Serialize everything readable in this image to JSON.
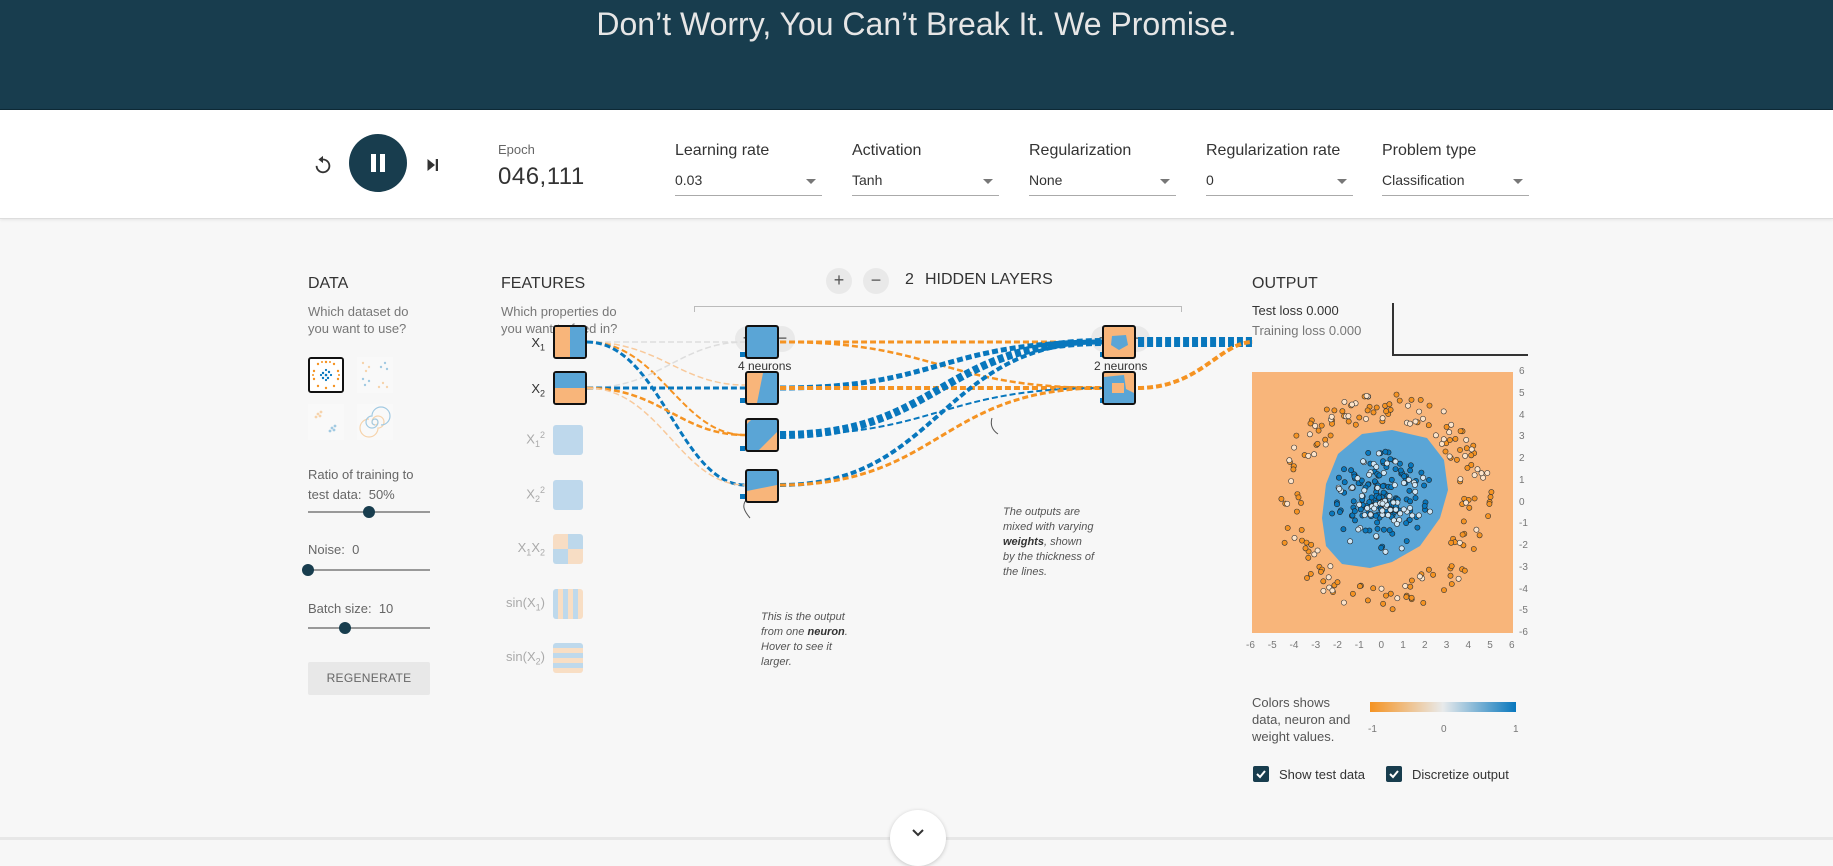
{
  "banner": {
    "title": "Don’t Worry, You Can’t Break It. We Promise."
  },
  "controls": {
    "epoch_label": "Epoch",
    "epoch_value": "046,111",
    "learning_rate": {
      "label": "Learning rate",
      "value": "0.03"
    },
    "activation": {
      "label": "Activation",
      "value": "Tanh"
    },
    "regularization": {
      "label": "Regularization",
      "value": "None"
    },
    "regularization_rate": {
      "label": "Regularization rate",
      "value": "0"
    },
    "problem_type": {
      "label": "Problem type",
      "value": "Classification"
    }
  },
  "data_panel": {
    "title": "DATA",
    "subtitle_1": "Which dataset do",
    "subtitle_2": "you want to use?",
    "ratio_label_1": "Ratio of training to",
    "ratio_label_2": "test data:",
    "ratio_value": "50%",
    "ratio_fraction": 0.5,
    "noise_label": "Noise:",
    "noise_value": "0",
    "noise_fraction": 0,
    "batch_label": "Batch size:",
    "batch_value": "10",
    "batch_fraction": 0.3,
    "regenerate_label": "REGENERATE"
  },
  "features_panel": {
    "title": "FEATURES",
    "subtitle_1": "Which properties do",
    "subtitle_2": "you want to feed in?",
    "features": [
      {
        "base": "X",
        "sub": "1",
        "sup": "",
        "active": true
      },
      {
        "base": "X",
        "sub": "2",
        "sup": "",
        "active": true
      },
      {
        "base": "X",
        "sub": "1",
        "sup": "2",
        "active": false
      },
      {
        "base": "X",
        "sub": "2",
        "sup": "2",
        "active": false
      },
      {
        "base": "X",
        "sub": "1",
        "sup": "",
        "base2": "X",
        "sub2": "2",
        "active": false
      },
      {
        "base": "sin(X",
        "sub": "1",
        "sup": "",
        "suffix": ")",
        "active": false
      },
      {
        "base": "sin(X",
        "sub": "2",
        "sup": "",
        "suffix": ")",
        "active": false
      }
    ]
  },
  "hidden_layers": {
    "count": "2",
    "label": "HIDDEN LAYERS",
    "layer1_neurons": "4 neurons",
    "layer2_neurons": "2 neurons"
  },
  "annotations": {
    "neuron_note_1": "This is the output",
    "neuron_note_2": "from one",
    "neuron_note_bold": "neuron",
    "neuron_note_3": "Hover to see it",
    "neuron_note_4": "larger.",
    "weights_note_1": "The outputs are",
    "weights_note_2": "mixed with varying",
    "weights_note_bold": "weights",
    "weights_note_3": ", shown",
    "weights_note_4": "by the thickness of",
    "weights_note_5": "the lines."
  },
  "output_panel": {
    "title": "OUTPUT",
    "test_loss_label": "Test loss",
    "test_loss_value": "0.000",
    "training_loss_label": "Training loss",
    "training_loss_value": "0.000",
    "axis_ticks": [
      "-6",
      "-5",
      "-4",
      "-3",
      "-2",
      "-1",
      "0",
      "1",
      "2",
      "3",
      "4",
      "5",
      "6"
    ],
    "y_axis_ticks": [
      "6",
      "5",
      "4",
      "3",
      "2",
      "1",
      "0",
      "-1",
      "-2",
      "-3",
      "-4",
      "-5",
      "-6"
    ],
    "legend_text_1": "Colors shows",
    "legend_text_2": "data, neuron and",
    "legend_text_3": "weight values.",
    "legend_min": "-1",
    "legend_mid": "0",
    "legend_max": "1",
    "show_test_data_label": "Show test data",
    "discretize_output_label": "Discretize output"
  },
  "colors": {
    "orange": "#f59322",
    "blue": "#0877bd",
    "bg_orange": "#f8b57a",
    "bg_blue": "#5aa5d6",
    "dark_navy": "#183d4e"
  }
}
